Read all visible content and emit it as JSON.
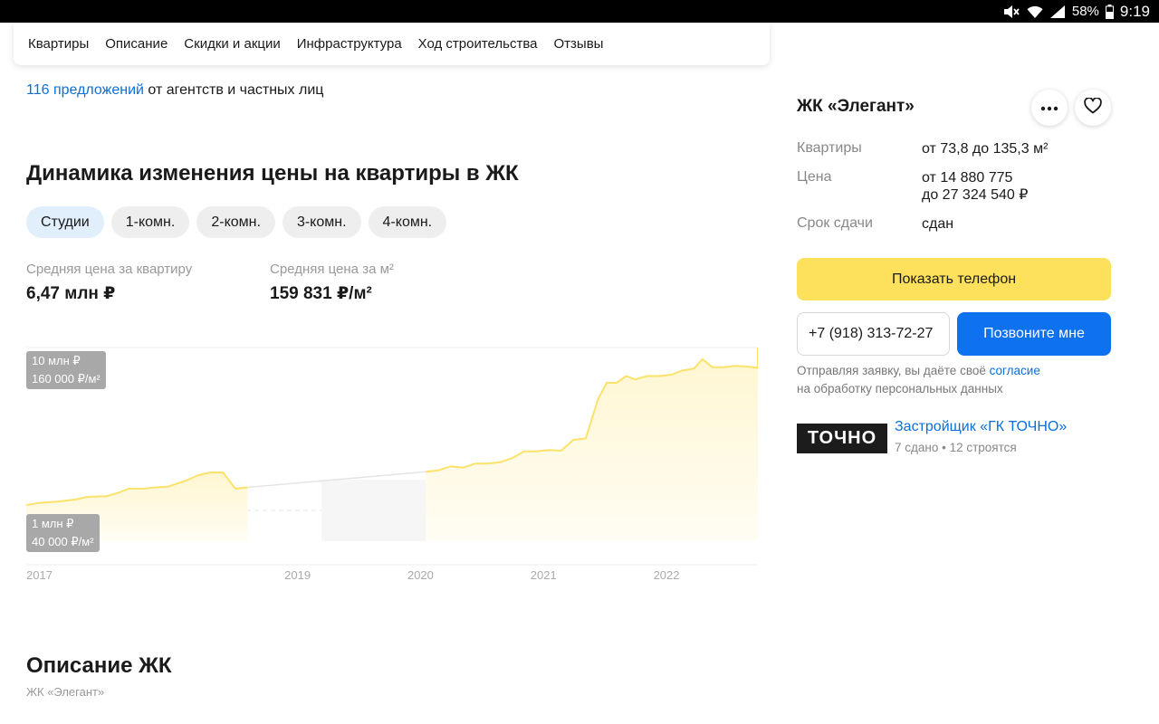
{
  "status_bar": {
    "battery": "58%",
    "time": "9:19"
  },
  "tabs": [
    {
      "label": "Квартиры"
    },
    {
      "label": "Описание"
    },
    {
      "label": "Скидки и акции"
    },
    {
      "label": "Инфраструктура"
    },
    {
      "label": "Ход строительства"
    },
    {
      "label": "Отзывы"
    }
  ],
  "offers": {
    "link": "116 предложений",
    "rest": " от агентств и частных лиц"
  },
  "price_section": {
    "title": "Динамика изменения цены на квартиры в ЖК",
    "filters": [
      "Студии",
      "1-комн.",
      "2-комн.",
      "3-комн.",
      "4-комн."
    ],
    "active_filter": "Студии",
    "avg_price_label": "Средняя цена за квартиру",
    "avg_price_value": "6,47 млн ₽",
    "avg_m2_label": "Средняя цена за м²",
    "avg_m2_value": "159 831 ₽/м²"
  },
  "chart_data": {
    "type": "area",
    "y_labels": [
      {
        "line1": "10 млн ₽",
        "line2": "160 000 ₽/м²"
      },
      {
        "line1": "1 млн ₽",
        "line2": "40 000 ₽/м²"
      }
    ],
    "x_ticks": [
      {
        "label": "2017",
        "year": 2017.0
      },
      {
        "label": "2019",
        "year": 2019.1
      },
      {
        "label": "2020",
        "year": 2020.1
      },
      {
        "label": "2021",
        "year": 2021.1
      },
      {
        "label": "2022",
        "year": 2022.1
      }
    ],
    "x_range": [
      2017.0,
      2022.95
    ],
    "y_range_m2": [
      40000,
      160000
    ],
    "gap": [
      2019.4,
      2020.25
    ],
    "line_color": "#fbe26a",
    "series": [
      {
        "values": [
          [
            2017.0,
            44000
          ],
          [
            2017.1,
            45500
          ],
          [
            2017.25,
            46500
          ],
          [
            2017.4,
            48000
          ],
          [
            2017.5,
            50000
          ],
          [
            2017.65,
            50500
          ],
          [
            2017.75,
            53000
          ],
          [
            2017.83,
            56000
          ],
          [
            2017.95,
            56000
          ],
          [
            2018.05,
            57000
          ],
          [
            2018.15,
            57500
          ],
          [
            2018.3,
            62000
          ],
          [
            2018.4,
            66000
          ],
          [
            2018.5,
            68000
          ],
          [
            2018.6,
            68000
          ],
          [
            2018.7,
            56000
          ],
          [
            2018.8,
            57000
          ]
        ]
      },
      {
        "values": [
          [
            2020.25,
            68500
          ],
          [
            2020.35,
            69500
          ],
          [
            2020.45,
            72500
          ],
          [
            2020.55,
            71500
          ],
          [
            2020.65,
            74500
          ],
          [
            2020.75,
            74500
          ],
          [
            2020.85,
            75500
          ],
          [
            2020.95,
            78500
          ],
          [
            2021.05,
            83500
          ],
          [
            2021.15,
            83500
          ],
          [
            2021.25,
            84500
          ],
          [
            2021.35,
            84000
          ],
          [
            2021.45,
            92000
          ],
          [
            2021.55,
            93000
          ],
          [
            2021.65,
            122000
          ],
          [
            2021.72,
            134000
          ],
          [
            2021.8,
            134000
          ],
          [
            2021.88,
            139000
          ],
          [
            2021.95,
            136500
          ],
          [
            2022.05,
            139000
          ],
          [
            2022.15,
            139000
          ],
          [
            2022.25,
            140000
          ],
          [
            2022.33,
            143000
          ],
          [
            2022.43,
            144500
          ],
          [
            2022.5,
            151500
          ],
          [
            2022.58,
            145500
          ],
          [
            2022.68,
            145500
          ],
          [
            2022.76,
            146500
          ],
          [
            2022.86,
            146000
          ],
          [
            2022.95,
            145000
          ],
          [
            2023.05,
            157500
          ],
          [
            2023.15,
            159000
          ],
          [
            2023.25,
            160000
          ],
          [
            2023.4,
            160000
          ]
        ]
      }
    ]
  },
  "description": {
    "title": "Описание ЖК",
    "subtitle": "ЖК «Элегант»"
  },
  "complex": {
    "title": "ЖК «Элегант»",
    "apartments_label": "Квартиры",
    "apartments_value": "от 73,8 до 135,3 м²",
    "price_label": "Цена",
    "price_from": "от 14 880 775",
    "price_to": "до 27 324 540 ₽",
    "deadline_label": "Срок сдачи",
    "deadline_value": "сдан",
    "show_phone": "Показать телефон",
    "phone_value": "+7 (918) 313-72-27",
    "call_me": "Позвоните мне",
    "consent_text": "Отправляя заявку, вы даёте своё ",
    "consent_link": "согласие",
    "consent_tail": "на обработку персональных данных"
  },
  "developer": {
    "logo_text": "ТОЧНО",
    "name": "Застройщик «ГК ТОЧНО»",
    "stats": "7 сдано • 12 строятся"
  }
}
